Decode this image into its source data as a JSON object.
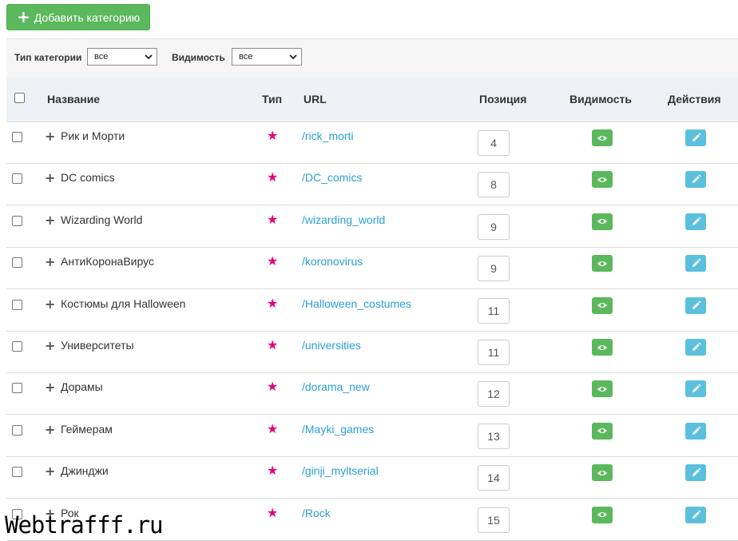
{
  "toolbar": {
    "add_category_label": "Добавить категорию"
  },
  "filters": {
    "category_type_label": "Тип категории",
    "category_type_value": "все",
    "visibility_label": "Видимость",
    "visibility_value": "все"
  },
  "table": {
    "columns": [
      "Название",
      "Тип",
      "URL",
      "Позиция",
      "Видимость",
      "Действия"
    ],
    "rows": [
      {
        "name": "Рик и Морти",
        "url": "/rick_morti",
        "position": "4"
      },
      {
        "name": "DC comics",
        "url": "/DC_comics",
        "position": "8"
      },
      {
        "name": "Wizarding World",
        "url": "/wizarding_world",
        "position": "9"
      },
      {
        "name": "АнтиКоронаВирус",
        "url": "/koronovirus",
        "position": "9"
      },
      {
        "name": "Костюмы для Halloween",
        "url": "/Halloween_costumes",
        "position": "11"
      },
      {
        "name": "Университеты",
        "url": "/universities",
        "position": "11"
      },
      {
        "name": "Дорамы",
        "url": "/dorama_new",
        "position": "12"
      },
      {
        "name": "Геймерам",
        "url": "/Mayki_games",
        "position": "13"
      },
      {
        "name": "Джинджи",
        "url": "/ginji_myltserial",
        "position": "14"
      },
      {
        "name": "Рок",
        "url": "/Rock",
        "position": "15"
      }
    ]
  },
  "watermark": "Webtrafff.ru",
  "colors": {
    "success": "#5cb85c",
    "info": "#5bc0de",
    "link": "#2a9fd6",
    "star": "#e6007e"
  },
  "icons": {
    "add": "plus-icon",
    "type": "star-icon",
    "visibility": "eye-icon",
    "edit": "pencil-icon",
    "expand": "expand-plus-icon"
  }
}
